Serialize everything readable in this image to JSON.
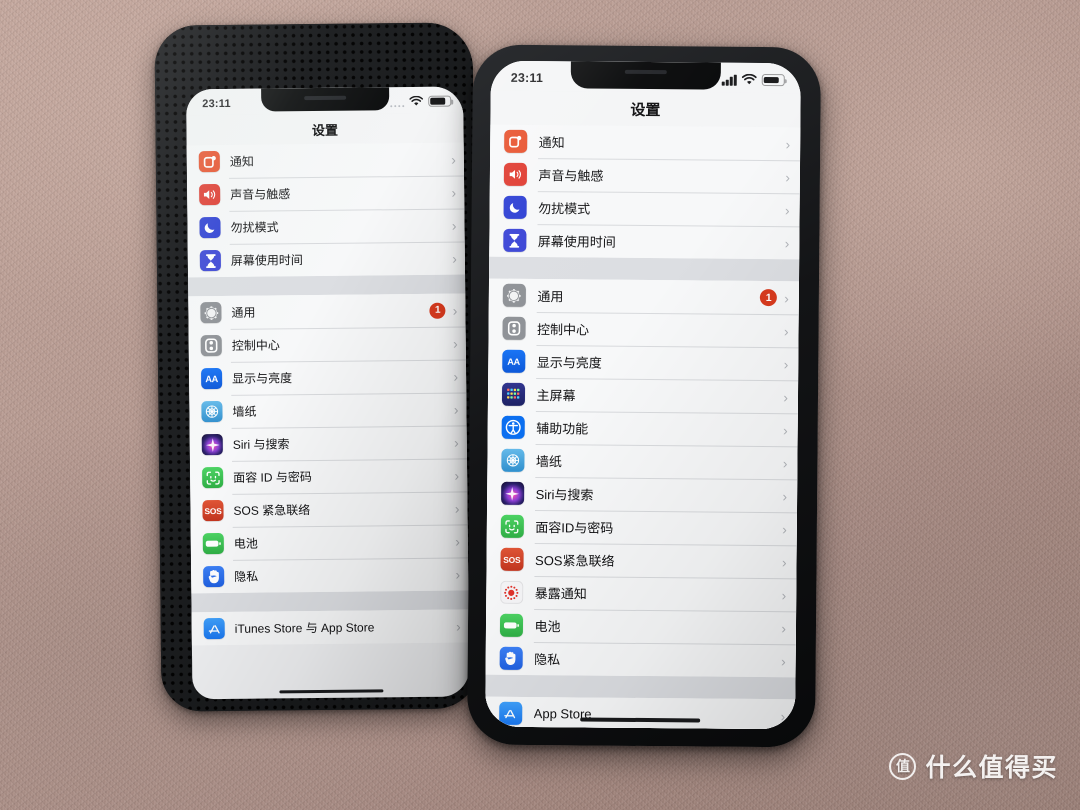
{
  "scene": {
    "description": "Two iPhones side by side on a fuzzy mauve fabric showing the iOS Settings app",
    "background_color": "#b49a93"
  },
  "watermark": {
    "logo_glyph": "值",
    "text": "什么值得买"
  },
  "icon_colors": {
    "notifications": "#e8502b",
    "sounds": "#e03a2f",
    "dnd": "#2d3fd4",
    "screen_time": "#3b45d6",
    "general": "#8e9196",
    "control_center": "#8e9196",
    "display": "#0a62e8",
    "home_screen": "#262a80",
    "accessibility": "#0a6ef0",
    "wallpaper": "#49a7df",
    "siri": "#1c1535",
    "face_id": "#3ac151",
    "sos": "#d2412b",
    "exposure": "#f4f4f6",
    "battery": "#3ac151",
    "privacy": "#2b6ff0",
    "app_store": "#2b8ef5",
    "badge": "#d83a1e"
  },
  "left_phone": {
    "name": "iPhone in perforated black case",
    "status_bar": {
      "time": "23:11",
      "signal": "faint-dots",
      "wifi": "wifi-icon",
      "battery": "battery-icon"
    },
    "nav_title": "设置",
    "groups": [
      {
        "rows": [
          {
            "label": "通知",
            "icon": "notifications",
            "badge": null
          },
          {
            "label": "声音与触感",
            "icon": "sounds",
            "badge": null
          },
          {
            "label": "勿扰模式",
            "icon": "dnd",
            "badge": null
          },
          {
            "label": "屏幕使用时间",
            "icon": "screen_time",
            "badge": null
          }
        ]
      },
      {
        "rows": [
          {
            "label": "通用",
            "icon": "general",
            "badge": "1"
          },
          {
            "label": "控制中心",
            "icon": "control_center",
            "badge": null
          },
          {
            "label": "显示与亮度",
            "icon": "display",
            "badge": null
          },
          {
            "label": "墙纸",
            "icon": "wallpaper",
            "badge": null
          },
          {
            "label": "Siri 与搜索",
            "icon": "siri",
            "badge": null
          },
          {
            "label": "面容 ID 与密码",
            "icon": "face_id",
            "badge": null
          },
          {
            "label": "SOS 紧急联络",
            "icon": "sos",
            "badge": null
          },
          {
            "label": "电池",
            "icon": "battery",
            "badge": null
          },
          {
            "label": "隐私",
            "icon": "privacy",
            "badge": null
          }
        ]
      },
      {
        "rows": [
          {
            "label": "iTunes Store 与 App Store",
            "icon": "app_store",
            "badge": null
          }
        ]
      }
    ]
  },
  "right_phone": {
    "name": "iPhone without case, dark bezel",
    "status_bar": {
      "time": "23:11",
      "signal": "4-bars",
      "wifi": "wifi-icon",
      "battery": "battery-icon"
    },
    "nav_title": "设置",
    "groups": [
      {
        "rows": [
          {
            "label": "通知",
            "icon": "notifications",
            "badge": null
          },
          {
            "label": "声音与触感",
            "icon": "sounds",
            "badge": null
          },
          {
            "label": "勿扰模式",
            "icon": "dnd",
            "badge": null
          },
          {
            "label": "屏幕使用时间",
            "icon": "screen_time",
            "badge": null
          }
        ]
      },
      {
        "rows": [
          {
            "label": "通用",
            "icon": "general",
            "badge": "1"
          },
          {
            "label": "控制中心",
            "icon": "control_center",
            "badge": null
          },
          {
            "label": "显示与亮度",
            "icon": "display",
            "badge": null
          },
          {
            "label": "主屏幕",
            "icon": "home_screen",
            "badge": null
          },
          {
            "label": "辅助功能",
            "icon": "accessibility",
            "badge": null
          },
          {
            "label": "墙纸",
            "icon": "wallpaper",
            "badge": null
          },
          {
            "label": "Siri与搜索",
            "icon": "siri",
            "badge": null
          },
          {
            "label": "面容ID与密码",
            "icon": "face_id",
            "badge": null
          },
          {
            "label": "SOS紧急联络",
            "icon": "sos",
            "badge": null
          },
          {
            "label": "暴露通知",
            "icon": "exposure",
            "badge": null
          },
          {
            "label": "电池",
            "icon": "battery",
            "badge": null
          },
          {
            "label": "隐私",
            "icon": "privacy",
            "badge": null
          }
        ]
      },
      {
        "rows": [
          {
            "label": "App Store",
            "icon": "app_store",
            "badge": null
          }
        ]
      }
    ]
  }
}
